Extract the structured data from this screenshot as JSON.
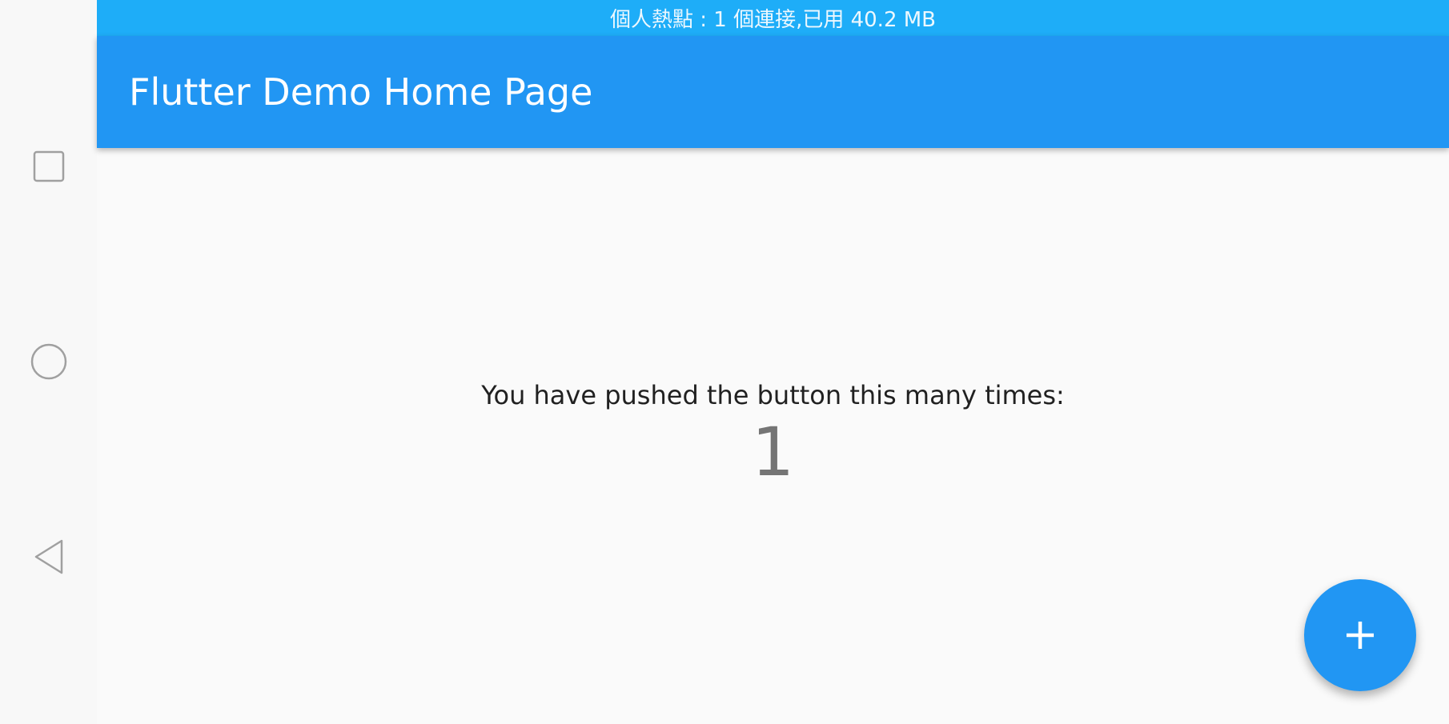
{
  "status_bar": {
    "text": "個人熱點 : 1 個連接,已用 40.2 MB"
  },
  "nav_bar": {
    "recents_icon": "square-icon",
    "home_icon": "circle-icon",
    "back_icon": "triangle-back-icon"
  },
  "app_bar": {
    "title": "Flutter Demo Home Page",
    "color": "#2196f3"
  },
  "main": {
    "message": "You have pushed the button this many times:",
    "counter": "1"
  },
  "fab": {
    "icon": "plus-icon",
    "color": "#2196f3"
  }
}
